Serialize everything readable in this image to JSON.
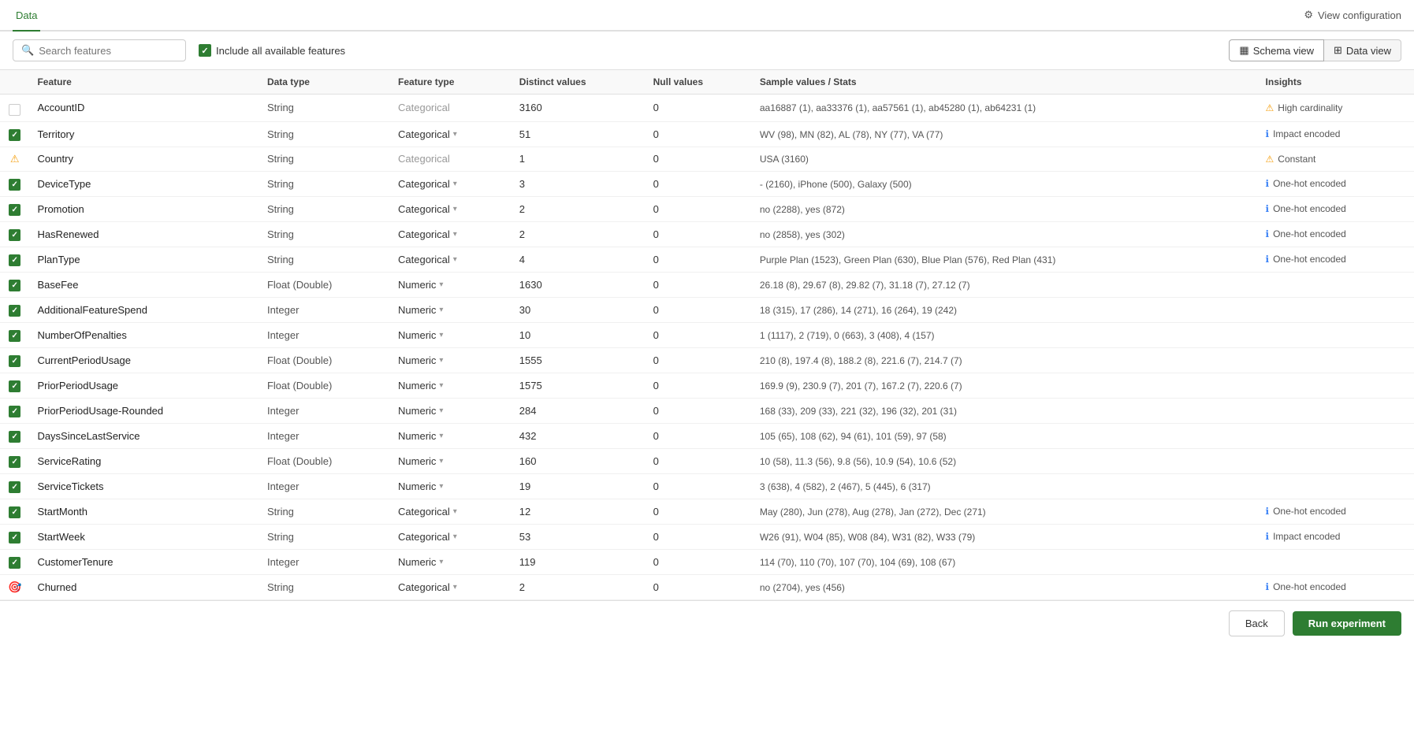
{
  "topBar": {
    "tabLabel": "Data",
    "viewConfigLabel": "View configuration"
  },
  "toolbar": {
    "searchPlaceholder": "Search features",
    "includeAllLabel": "Include all available features",
    "schemaViewLabel": "Schema view",
    "dataViewLabel": "Data view"
  },
  "columns": {
    "feature": "Feature",
    "dataType": "Data type",
    "featureType": "Feature type",
    "distinctValues": "Distinct values",
    "nullValues": "Null values",
    "sampleValues": "Sample values / Stats",
    "insights": "Insights"
  },
  "rows": [
    {
      "checkbox": "unchecked",
      "feature": "AccountID",
      "dataType": "String",
      "featureType": "Categorical",
      "featureTypeActive": false,
      "hasChevron": false,
      "distinctValues": "3160",
      "nullValues": "0",
      "sampleValues": "aa16887 (1), aa33376 (1), aa57561 (1), ab45280 (1), ab64231 (1)",
      "insightType": "warning",
      "insightText": "High cardinality"
    },
    {
      "checkbox": "checked",
      "feature": "Territory",
      "dataType": "String",
      "featureType": "Categorical",
      "featureTypeActive": true,
      "hasChevron": true,
      "distinctValues": "51",
      "nullValues": "0",
      "sampleValues": "WV (98), MN (82), AL (78), NY (77), VA (77)",
      "insightType": "info",
      "insightText": "Impact encoded"
    },
    {
      "checkbox": "warning",
      "feature": "Country",
      "dataType": "String",
      "featureType": "Categorical",
      "featureTypeActive": false,
      "hasChevron": false,
      "distinctValues": "1",
      "nullValues": "0",
      "sampleValues": "USA (3160)",
      "insightType": "warning",
      "insightText": "Constant"
    },
    {
      "checkbox": "checked",
      "feature": "DeviceType",
      "dataType": "String",
      "featureType": "Categorical",
      "featureTypeActive": true,
      "hasChevron": true,
      "distinctValues": "3",
      "nullValues": "0",
      "sampleValues": "- (2160), iPhone (500), Galaxy (500)",
      "insightType": "info",
      "insightText": "One-hot encoded"
    },
    {
      "checkbox": "checked",
      "feature": "Promotion",
      "dataType": "String",
      "featureType": "Categorical",
      "featureTypeActive": true,
      "hasChevron": true,
      "distinctValues": "2",
      "nullValues": "0",
      "sampleValues": "no (2288), yes (872)",
      "insightType": "info",
      "insightText": "One-hot encoded"
    },
    {
      "checkbox": "checked",
      "feature": "HasRenewed",
      "dataType": "String",
      "featureType": "Categorical",
      "featureTypeActive": true,
      "hasChevron": true,
      "distinctValues": "2",
      "nullValues": "0",
      "sampleValues": "no (2858), yes (302)",
      "insightType": "info",
      "insightText": "One-hot encoded"
    },
    {
      "checkbox": "checked",
      "feature": "PlanType",
      "dataType": "String",
      "featureType": "Categorical",
      "featureTypeActive": true,
      "hasChevron": true,
      "distinctValues": "4",
      "nullValues": "0",
      "sampleValues": "Purple Plan (1523), Green Plan (630), Blue Plan (576), Red Plan (431)",
      "insightType": "info",
      "insightText": "One-hot encoded"
    },
    {
      "checkbox": "checked",
      "feature": "BaseFee",
      "dataType": "Float (Double)",
      "featureType": "Numeric",
      "featureTypeActive": true,
      "hasChevron": true,
      "distinctValues": "1630",
      "nullValues": "0",
      "sampleValues": "26.18 (8), 29.67 (8), 29.82 (7), 31.18 (7), 27.12 (7)",
      "insightType": "none",
      "insightText": ""
    },
    {
      "checkbox": "checked",
      "feature": "AdditionalFeatureSpend",
      "dataType": "Integer",
      "featureType": "Numeric",
      "featureTypeActive": true,
      "hasChevron": true,
      "distinctValues": "30",
      "nullValues": "0",
      "sampleValues": "18 (315), 17 (286), 14 (271), 16 (264), 19 (242)",
      "insightType": "none",
      "insightText": ""
    },
    {
      "checkbox": "checked",
      "feature": "NumberOfPenalties",
      "dataType": "Integer",
      "featureType": "Numeric",
      "featureTypeActive": true,
      "hasChevron": true,
      "distinctValues": "10",
      "nullValues": "0",
      "sampleValues": "1 (1117), 2 (719), 0 (663), 3 (408), 4 (157)",
      "insightType": "none",
      "insightText": ""
    },
    {
      "checkbox": "checked",
      "feature": "CurrentPeriodUsage",
      "dataType": "Float (Double)",
      "featureType": "Numeric",
      "featureTypeActive": true,
      "hasChevron": true,
      "distinctValues": "1555",
      "nullValues": "0",
      "sampleValues": "210 (8), 197.4 (8), 188.2 (8), 221.6 (7), 214.7 (7)",
      "insightType": "none",
      "insightText": ""
    },
    {
      "checkbox": "checked",
      "feature": "PriorPeriodUsage",
      "dataType": "Float (Double)",
      "featureType": "Numeric",
      "featureTypeActive": true,
      "hasChevron": true,
      "distinctValues": "1575",
      "nullValues": "0",
      "sampleValues": "169.9 (9), 230.9 (7), 201 (7), 167.2 (7), 220.6 (7)",
      "insightType": "none",
      "insightText": ""
    },
    {
      "checkbox": "checked",
      "feature": "PriorPeriodUsage-Rounded",
      "dataType": "Integer",
      "featureType": "Numeric",
      "featureTypeActive": true,
      "hasChevron": true,
      "distinctValues": "284",
      "nullValues": "0",
      "sampleValues": "168 (33), 209 (33), 221 (32), 196 (32), 201 (31)",
      "insightType": "none",
      "insightText": ""
    },
    {
      "checkbox": "checked",
      "feature": "DaysSinceLastService",
      "dataType": "Integer",
      "featureType": "Numeric",
      "featureTypeActive": true,
      "hasChevron": true,
      "distinctValues": "432",
      "nullValues": "0",
      "sampleValues": "105 (65), 108 (62), 94 (61), 101 (59), 97 (58)",
      "insightType": "none",
      "insightText": ""
    },
    {
      "checkbox": "checked",
      "feature": "ServiceRating",
      "dataType": "Float (Double)",
      "featureType": "Numeric",
      "featureTypeActive": true,
      "hasChevron": true,
      "distinctValues": "160",
      "nullValues": "0",
      "sampleValues": "10 (58), 11.3 (56), 9.8 (56), 10.9 (54), 10.6 (52)",
      "insightType": "none",
      "insightText": ""
    },
    {
      "checkbox": "checked",
      "feature": "ServiceTickets",
      "dataType": "Integer",
      "featureType": "Numeric",
      "featureTypeActive": true,
      "hasChevron": true,
      "distinctValues": "19",
      "nullValues": "0",
      "sampleValues": "3 (638), 4 (582), 2 (467), 5 (445), 6 (317)",
      "insightType": "none",
      "insightText": ""
    },
    {
      "checkbox": "checked",
      "feature": "StartMonth",
      "dataType": "String",
      "featureType": "Categorical",
      "featureTypeActive": true,
      "hasChevron": true,
      "distinctValues": "12",
      "nullValues": "0",
      "sampleValues": "May (280), Jun (278), Aug (278), Jan (272), Dec (271)",
      "insightType": "info",
      "insightText": "One-hot encoded"
    },
    {
      "checkbox": "checked",
      "feature": "StartWeek",
      "dataType": "String",
      "featureType": "Categorical",
      "featureTypeActive": true,
      "hasChevron": true,
      "distinctValues": "53",
      "nullValues": "0",
      "sampleValues": "W26 (91), W04 (85), W08 (84), W31 (82), W33 (79)",
      "insightType": "info",
      "insightText": "Impact encoded"
    },
    {
      "checkbox": "checked",
      "feature": "CustomerTenure",
      "dataType": "Integer",
      "featureType": "Numeric",
      "featureTypeActive": true,
      "hasChevron": true,
      "distinctValues": "119",
      "nullValues": "0",
      "sampleValues": "114 (70), 110 (70), 107 (70), 104 (69), 108 (67)",
      "insightType": "none",
      "insightText": ""
    },
    {
      "checkbox": "target",
      "feature": "Churned",
      "dataType": "String",
      "featureType": "Categorical",
      "featureTypeActive": true,
      "hasChevron": true,
      "distinctValues": "2",
      "nullValues": "0",
      "sampleValues": "no (2704), yes (456)",
      "insightType": "info",
      "insightText": "One-hot encoded"
    }
  ],
  "bottomBar": {
    "backLabel": "Back",
    "runLabel": "Run experiment"
  }
}
